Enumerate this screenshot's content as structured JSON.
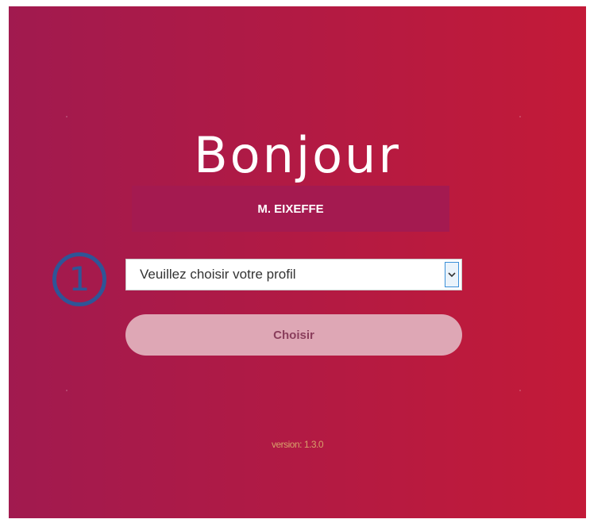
{
  "greeting": "Bonjour",
  "user": {
    "name": "M. EIXEFFE"
  },
  "step_badge": "1",
  "profile_select": {
    "selected_label": "Veuillez choisir votre profil"
  },
  "choose_button": {
    "label": "Choisir"
  },
  "version": "version: 1.3.0",
  "colors": {
    "gradient_start": "#a11a4f",
    "gradient_end": "#c31a38",
    "name_band": "#a41a50",
    "button_bg": "#dea7b5",
    "badge": "#2f5597"
  },
  "icons": {
    "select_arrow": "chevron-down-icon"
  }
}
